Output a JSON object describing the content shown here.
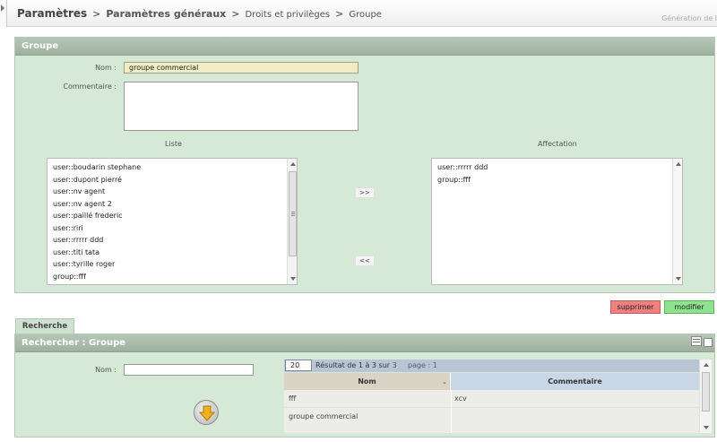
{
  "breadcrumb": {
    "root": "Paramètres",
    "level2": "Paramètres généraux",
    "level3": "Droits et privilèges",
    "level4": "Groupe",
    "separator": ">",
    "top_right_text": "Génération de l"
  },
  "group_panel": {
    "title": "Groupe",
    "name_label": "Nom :",
    "name_value": "groupe commercial",
    "comment_label": "Commentaire :",
    "comment_value": "",
    "list_title": "Liste",
    "assign_title": "Affectation",
    "list_items": [
      "user::boudarin stephane",
      "user::dupont pierré",
      "user::nv agent",
      "user::nv agent 2",
      "user::paillé frederic",
      "user::riri",
      "user::rrrrr ddd",
      "user::titi tata",
      "user::tyrille roger",
      "group::fff"
    ],
    "assigned_items": [
      "user::rrrrr ddd",
      "group::fff"
    ],
    "add_button": ">>",
    "remove_button": "<<"
  },
  "actions": {
    "delete_label": "supprimer",
    "modify_label": "modifier"
  },
  "search_tab": {
    "tab_label": "Recherche",
    "panel_title": "Rechercher : Groupe",
    "name_label": "Nom :",
    "name_value": ""
  },
  "results": {
    "per_page": "20",
    "result_prefix": "Résultat de 1 à 3 sur",
    "result_total": "3",
    "page_text": "page : 1",
    "columns": [
      "Nom",
      "Commentaire"
    ],
    "rows": [
      {
        "nom": "fff",
        "commentaire": "xcv"
      },
      {
        "nom": "groupe commercial",
        "commentaire": ""
      }
    ]
  },
  "colors": {
    "panel_bg": "#d6e8d6",
    "panel_header": "#a9bba9",
    "delete_button": "#ee8080",
    "modify_button": "#8ee48e",
    "name_field_bg": "#f0ecc4"
  }
}
